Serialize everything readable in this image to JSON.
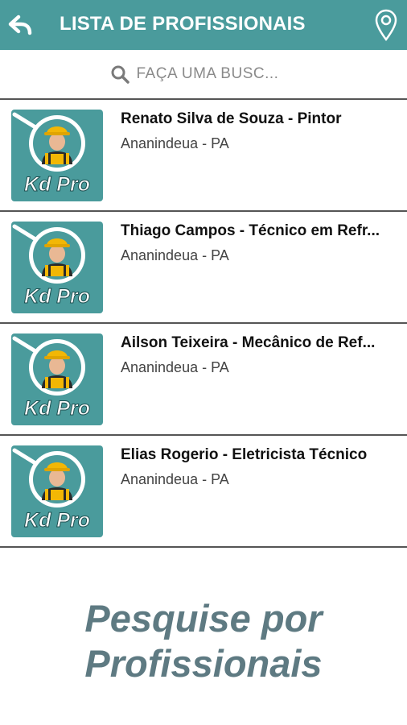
{
  "app_bar": {
    "title": "LISTA DE PROFISSIONAIS",
    "back_icon": "back-arrow-icon",
    "location_icon": "map-pin-icon",
    "background_color": "#4a9b9c"
  },
  "search": {
    "placeholder": "FAÇA UMA BUSC...",
    "icon": "search-icon"
  },
  "professionals": [
    {
      "name": "Renato Silva de Souza - Pintor",
      "location": "Ananindeua - PA",
      "logo_text": "Kd Pro"
    },
    {
      "name": "Thiago Campos - Técnico em Refr...",
      "location": "Ananindeua - PA",
      "logo_text": "Kd Pro"
    },
    {
      "name": "Ailson Teixeira - Mecânico de Ref...",
      "location": "Ananindeua - PA",
      "logo_text": "Kd Pro"
    },
    {
      "name": "Elias Rogerio - Eletricista Técnico",
      "location": "Ananindeua - PA",
      "logo_text": "Kd Pro"
    }
  ],
  "footer": {
    "line1": "Pesquise por",
    "line2": "Profissionais",
    "color": "#5e7a82"
  }
}
